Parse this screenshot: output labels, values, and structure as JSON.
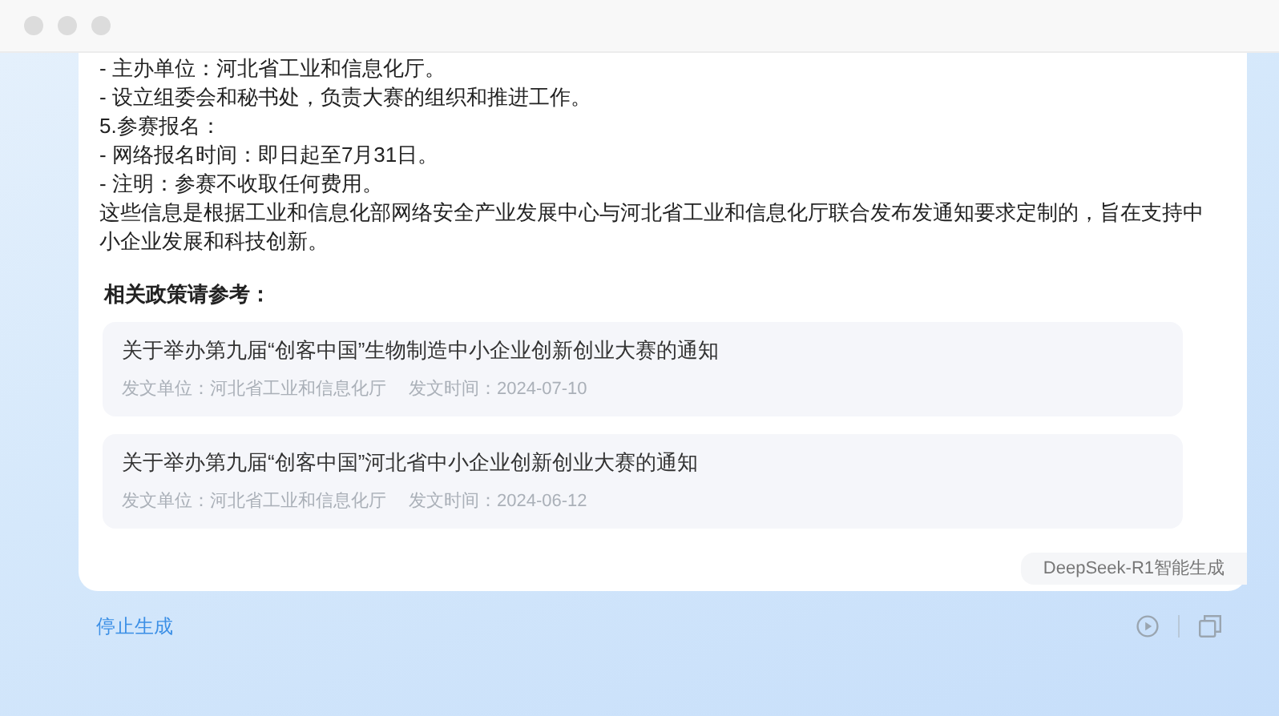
{
  "answer": {
    "lines": [
      "- 主办单位：河北省工业和信息化厅。",
      "- 设立组委会和秘书处，负责大赛的组织和推进工作。",
      "5.参赛报名：",
      "- 网络报名时间：即日起至7月31日。",
      "- 注明：参赛不收取任何费用。",
      "这些信息是根据工业和信息化部网络安全产业发展中心与河北省工业和信息化厅联合发布发通知要求定制的，旨在支持中小企业发展和科技创新。"
    ],
    "related_heading": "相关政策请参考：",
    "related": [
      {
        "title": "关于举办第九届“创客中国”生物制造中小企业创新创业大赛的通知",
        "publisher": "发文单位：河北省工业和信息化厅",
        "date": "发文时间：2024-07-10"
      },
      {
        "title": "关于举办第九届“创客中国”河北省中小企业创新创业大赛的通知",
        "publisher": "发文单位：河北省工业和信息化厅",
        "date": "发文时间：2024-06-12"
      }
    ],
    "generated_by": "DeepSeek-R1智能生成"
  },
  "stop_button": "停止生成"
}
